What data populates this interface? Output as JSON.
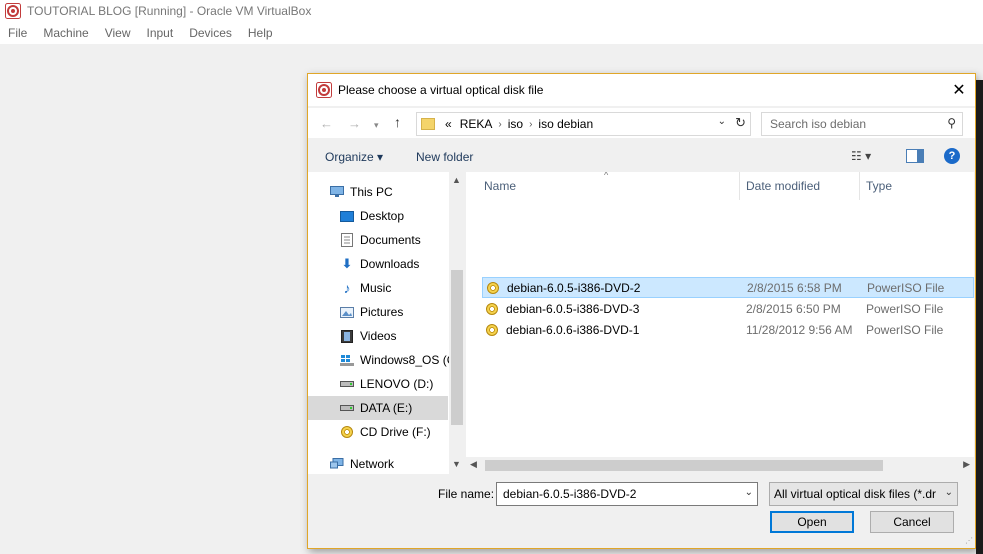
{
  "window": {
    "title": "TOUTORIAL BLOG [Running] - Oracle VM VirtualBox",
    "menu": [
      "File",
      "Machine",
      "View",
      "Input",
      "Devices",
      "Help"
    ]
  },
  "dialog": {
    "title": "Please choose a virtual optical disk file",
    "close_glyph": "✕",
    "address": {
      "prefix": "«",
      "parts": [
        "REKA",
        "iso",
        "iso debian"
      ]
    },
    "search_placeholder": "Search iso debian",
    "toolbar": {
      "organize": "Organize ▾",
      "new_folder": "New folder",
      "help": "?"
    },
    "nav_items": [
      {
        "label": "This PC",
        "icon": "computer-icon"
      },
      {
        "label": "Desktop",
        "icon": "desktop-icon"
      },
      {
        "label": "Documents",
        "icon": "documents-icon"
      },
      {
        "label": "Downloads",
        "icon": "downloads-icon"
      },
      {
        "label": "Music",
        "icon": "music-icon"
      },
      {
        "label": "Pictures",
        "icon": "pictures-icon"
      },
      {
        "label": "Videos",
        "icon": "videos-icon"
      },
      {
        "label": "Windows8_OS (C",
        "icon": "windows-drive-icon"
      },
      {
        "label": "LENOVO (D:)",
        "icon": "drive-icon"
      },
      {
        "label": "DATA (E:)",
        "icon": "drive-icon",
        "selected": true
      },
      {
        "label": "CD Drive (F:)",
        "icon": "cd-drive-icon"
      },
      {
        "label": "Network",
        "icon": "network-icon"
      }
    ],
    "columns": {
      "name": "Name",
      "date": "Date modified",
      "type": "Type"
    },
    "files": [
      {
        "name": "debian-6.0.5-i386-DVD-2",
        "date": "2/8/2015 6:58 PM",
        "type": "PowerISO File",
        "selected": true
      },
      {
        "name": "debian-6.0.5-i386-DVD-3",
        "date": "2/8/2015 6:50 PM",
        "type": "PowerISO File"
      },
      {
        "name": "debian-6.0.6-i386-DVD-1",
        "date": "11/28/2012 9:56 AM",
        "type": "PowerISO File"
      }
    ],
    "file_name_label": "File name:",
    "file_name_value": "debian-6.0.5-i386-DVD-2",
    "file_type_value": "All virtual optical disk files (*.dr",
    "open_label": "Open",
    "cancel_label": "Cancel"
  },
  "colors": {
    "accent": "#0078d7",
    "selection": "#cce8ff",
    "dialog_border": "#e0a628"
  }
}
